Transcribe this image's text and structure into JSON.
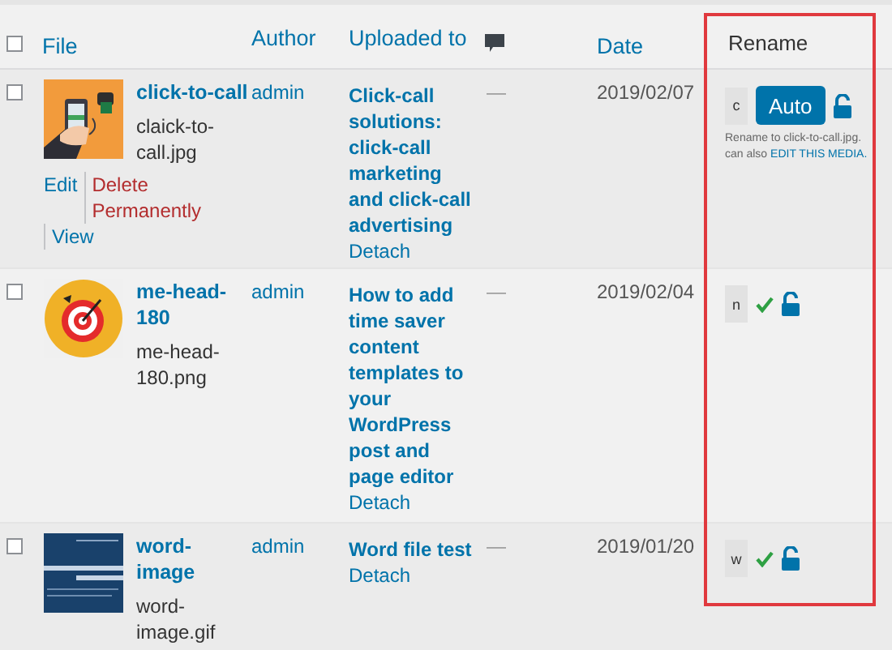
{
  "header": {
    "checked": false,
    "file": "File",
    "author": "Author",
    "uploaded_to": "Uploaded to",
    "date": "Date",
    "rename": "Rename"
  },
  "rows": [
    {
      "kind": "auto",
      "checked": false,
      "title": "click-to-call",
      "filename": "claick-to-call.jpg",
      "actions": [
        {
          "label": "Edit",
          "kind": "edit"
        },
        {
          "label": "Delete Permanently",
          "kind": "delete"
        },
        {
          "label": "View",
          "kind": "edit"
        }
      ],
      "author": "admin",
      "uploaded_to": "Click-call solutions: click-call marketing and click-call advertising",
      "detach": "Detach",
      "comments": "—",
      "date": "2019/02/07",
      "rename_value": "c",
      "auto_button": "Auto",
      "hint": "Rename to click-to-call.jpg.",
      "hint_2": "can also",
      "hint_link": "EDIT THIS MEDIA."
    },
    {
      "kind": "done",
      "checked": false,
      "title": "me-head-180",
      "filename": "me-head-180.png",
      "author": "admin",
      "uploaded_to": "How to add time saver content templates to your WordPress post and page editor",
      "detach": "Detach",
      "comments": "—",
      "date": "2019/02/04",
      "rename_value": "n"
    },
    {
      "kind": "done",
      "checked": false,
      "title": "word-image",
      "filename": "word-image.gif",
      "author": "admin",
      "uploaded_to": "Word file test",
      "detach": "Detach",
      "comments": "—",
      "date": "2019/01/20",
      "rename_value": "w"
    }
  ]
}
